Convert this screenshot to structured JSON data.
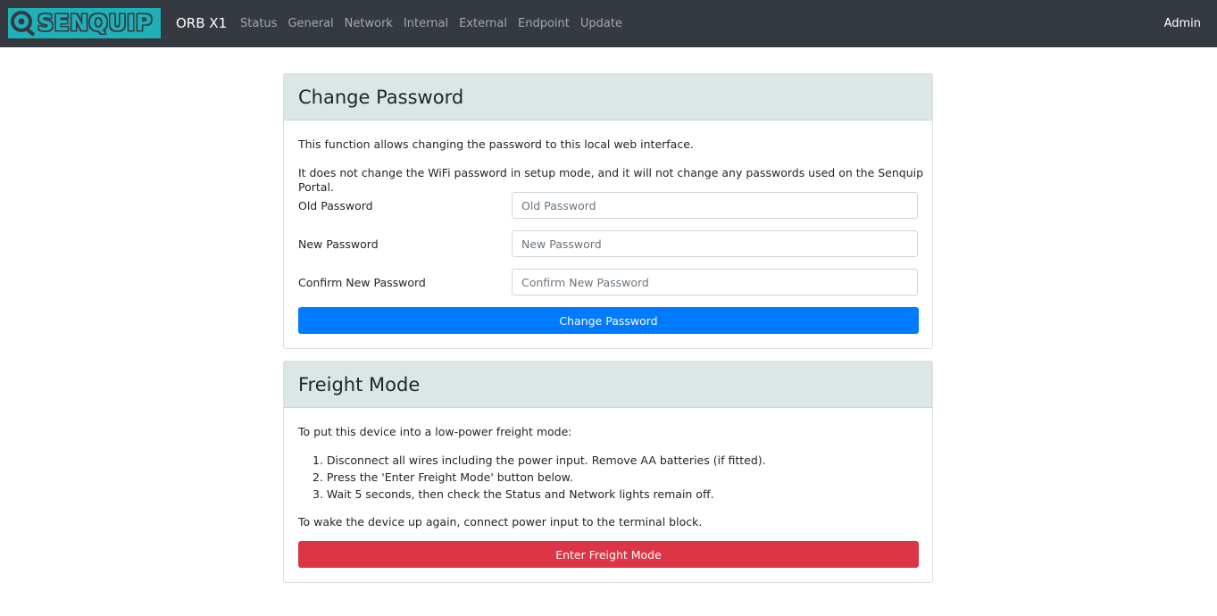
{
  "navbar": {
    "logo_text": "SENQUIP",
    "brand": "ORB X1",
    "links": [
      "Status",
      "General",
      "Network",
      "Internal",
      "External",
      "Endpoint",
      "Update"
    ],
    "user": "Admin"
  },
  "change_password": {
    "title": "Change Password",
    "desc1": "This function allows changing the password to this local web interface.",
    "desc2": "It does not change the WiFi password in setup mode, and it will not change any passwords used on the Senquip Portal.",
    "old_label": "Old Password",
    "old_placeholder": "Old Password",
    "new_label": "New Password",
    "new_placeholder": "New Password",
    "confirm_label": "Confirm New Password",
    "confirm_placeholder": "Confirm New Password",
    "button": "Change Password"
  },
  "freight_mode": {
    "title": "Freight Mode",
    "intro": "To put this device into a low-power freight mode:",
    "steps": [
      "1. Disconnect all wires including the power input. Remove AA batteries (if fitted).",
      "2. Press the 'Enter Freight Mode' button below.",
      "3. Wait 5 seconds, then check the Status and Network lights remain off."
    ],
    "wake": "To wake the device up again, connect power input to the terminal block.",
    "button": "Enter Freight Mode"
  },
  "colors": {
    "navbar": "#343a40",
    "logo": "#20b0b8",
    "primary": "#007bff",
    "danger": "#dc3545",
    "card_header": "#dae7e6"
  }
}
